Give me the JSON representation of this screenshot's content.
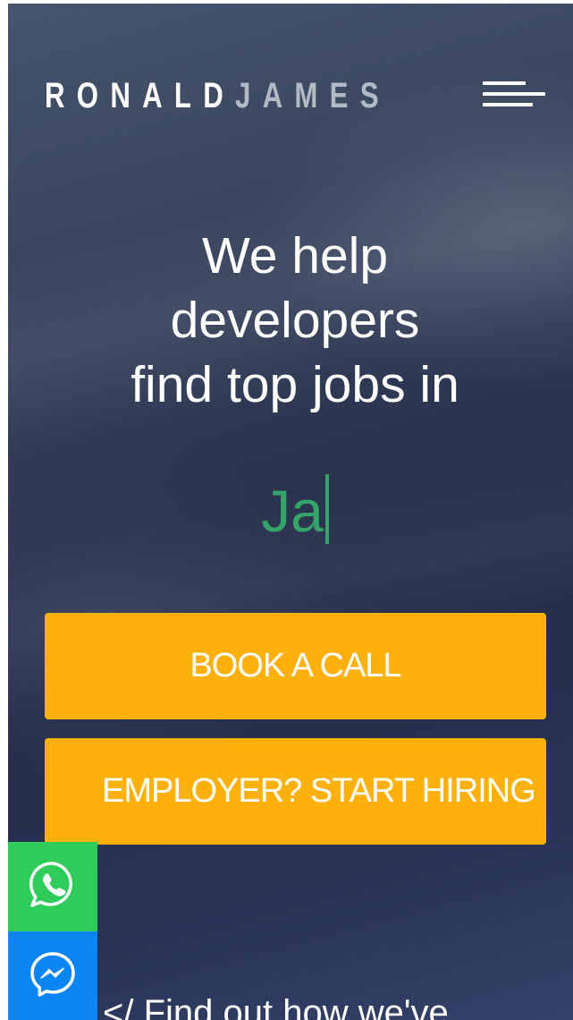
{
  "header": {
    "logo_first": "RONALD",
    "logo_last": "JAMES",
    "menu_icon": "hamburger-menu-icon"
  },
  "hero": {
    "headline_lines": [
      "We help",
      "developers",
      "find top jobs in"
    ],
    "typed_word": "Ja",
    "accent_color": "#36a46a"
  },
  "cta": {
    "book_label": "BOOK A CALL",
    "hire_label": "EMPLOYER? START HIRING",
    "button_color": "#feb10c"
  },
  "chat": {
    "whatsapp_icon": "whatsapp-icon",
    "whatsapp_color": "#2fcb5b",
    "messenger_icon": "messenger-icon",
    "messenger_color": "#0b84f4"
  },
  "section": {
    "tagline": "</ Find out how we've"
  }
}
